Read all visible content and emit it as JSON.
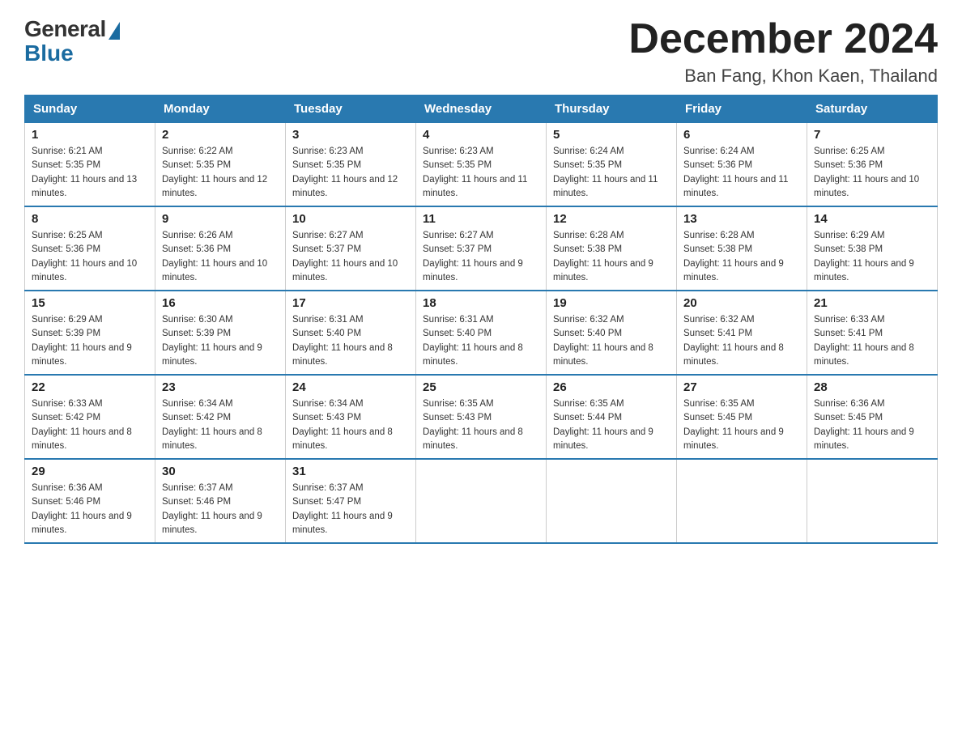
{
  "logo": {
    "general": "General",
    "blue": "Blue"
  },
  "title": "December 2024",
  "location": "Ban Fang, Khon Kaen, Thailand",
  "days_of_week": [
    "Sunday",
    "Monday",
    "Tuesday",
    "Wednesday",
    "Thursday",
    "Friday",
    "Saturday"
  ],
  "weeks": [
    [
      {
        "day": "1",
        "sunrise": "6:21 AM",
        "sunset": "5:35 PM",
        "daylight": "11 hours and 13 minutes."
      },
      {
        "day": "2",
        "sunrise": "6:22 AM",
        "sunset": "5:35 PM",
        "daylight": "11 hours and 12 minutes."
      },
      {
        "day": "3",
        "sunrise": "6:23 AM",
        "sunset": "5:35 PM",
        "daylight": "11 hours and 12 minutes."
      },
      {
        "day": "4",
        "sunrise": "6:23 AM",
        "sunset": "5:35 PM",
        "daylight": "11 hours and 11 minutes."
      },
      {
        "day": "5",
        "sunrise": "6:24 AM",
        "sunset": "5:35 PM",
        "daylight": "11 hours and 11 minutes."
      },
      {
        "day": "6",
        "sunrise": "6:24 AM",
        "sunset": "5:36 PM",
        "daylight": "11 hours and 11 minutes."
      },
      {
        "day": "7",
        "sunrise": "6:25 AM",
        "sunset": "5:36 PM",
        "daylight": "11 hours and 10 minutes."
      }
    ],
    [
      {
        "day": "8",
        "sunrise": "6:25 AM",
        "sunset": "5:36 PM",
        "daylight": "11 hours and 10 minutes."
      },
      {
        "day": "9",
        "sunrise": "6:26 AM",
        "sunset": "5:36 PM",
        "daylight": "11 hours and 10 minutes."
      },
      {
        "day": "10",
        "sunrise": "6:27 AM",
        "sunset": "5:37 PM",
        "daylight": "11 hours and 10 minutes."
      },
      {
        "day": "11",
        "sunrise": "6:27 AM",
        "sunset": "5:37 PM",
        "daylight": "11 hours and 9 minutes."
      },
      {
        "day": "12",
        "sunrise": "6:28 AM",
        "sunset": "5:38 PM",
        "daylight": "11 hours and 9 minutes."
      },
      {
        "day": "13",
        "sunrise": "6:28 AM",
        "sunset": "5:38 PM",
        "daylight": "11 hours and 9 minutes."
      },
      {
        "day": "14",
        "sunrise": "6:29 AM",
        "sunset": "5:38 PM",
        "daylight": "11 hours and 9 minutes."
      }
    ],
    [
      {
        "day": "15",
        "sunrise": "6:29 AM",
        "sunset": "5:39 PM",
        "daylight": "11 hours and 9 minutes."
      },
      {
        "day": "16",
        "sunrise": "6:30 AM",
        "sunset": "5:39 PM",
        "daylight": "11 hours and 9 minutes."
      },
      {
        "day": "17",
        "sunrise": "6:31 AM",
        "sunset": "5:40 PM",
        "daylight": "11 hours and 8 minutes."
      },
      {
        "day": "18",
        "sunrise": "6:31 AM",
        "sunset": "5:40 PM",
        "daylight": "11 hours and 8 minutes."
      },
      {
        "day": "19",
        "sunrise": "6:32 AM",
        "sunset": "5:40 PM",
        "daylight": "11 hours and 8 minutes."
      },
      {
        "day": "20",
        "sunrise": "6:32 AM",
        "sunset": "5:41 PM",
        "daylight": "11 hours and 8 minutes."
      },
      {
        "day": "21",
        "sunrise": "6:33 AM",
        "sunset": "5:41 PM",
        "daylight": "11 hours and 8 minutes."
      }
    ],
    [
      {
        "day": "22",
        "sunrise": "6:33 AM",
        "sunset": "5:42 PM",
        "daylight": "11 hours and 8 minutes."
      },
      {
        "day": "23",
        "sunrise": "6:34 AM",
        "sunset": "5:42 PM",
        "daylight": "11 hours and 8 minutes."
      },
      {
        "day": "24",
        "sunrise": "6:34 AM",
        "sunset": "5:43 PM",
        "daylight": "11 hours and 8 minutes."
      },
      {
        "day": "25",
        "sunrise": "6:35 AM",
        "sunset": "5:43 PM",
        "daylight": "11 hours and 8 minutes."
      },
      {
        "day": "26",
        "sunrise": "6:35 AM",
        "sunset": "5:44 PM",
        "daylight": "11 hours and 9 minutes."
      },
      {
        "day": "27",
        "sunrise": "6:35 AM",
        "sunset": "5:45 PM",
        "daylight": "11 hours and 9 minutes."
      },
      {
        "day": "28",
        "sunrise": "6:36 AM",
        "sunset": "5:45 PM",
        "daylight": "11 hours and 9 minutes."
      }
    ],
    [
      {
        "day": "29",
        "sunrise": "6:36 AM",
        "sunset": "5:46 PM",
        "daylight": "11 hours and 9 minutes."
      },
      {
        "day": "30",
        "sunrise": "6:37 AM",
        "sunset": "5:46 PM",
        "daylight": "11 hours and 9 minutes."
      },
      {
        "day": "31",
        "sunrise": "6:37 AM",
        "sunset": "5:47 PM",
        "daylight": "11 hours and 9 minutes."
      },
      null,
      null,
      null,
      null
    ]
  ],
  "labels": {
    "sunrise": "Sunrise:",
    "sunset": "Sunset:",
    "daylight": "Daylight:"
  }
}
